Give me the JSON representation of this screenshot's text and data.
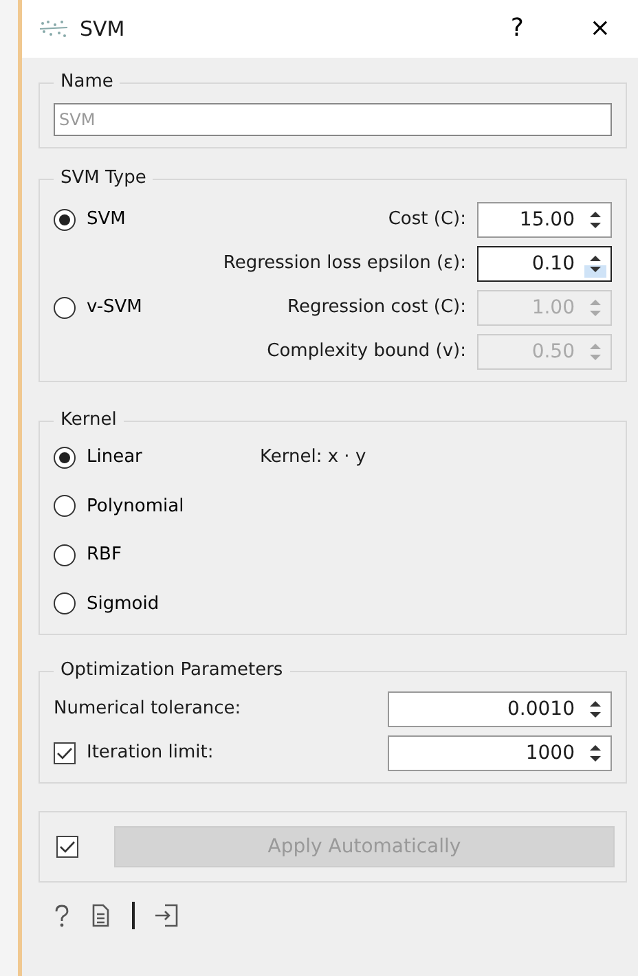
{
  "window": {
    "title": "SVM",
    "help": "?",
    "close": "×"
  },
  "name_box": {
    "title": "Name",
    "placeholder": "SVM"
  },
  "svm_type": {
    "title": "SVM Type",
    "options": [
      {
        "label": "SVM",
        "selected": true
      },
      {
        "label": "v-SVM",
        "selected": false
      }
    ],
    "params": [
      {
        "label": "Cost (C):",
        "value": "15.00",
        "disabled": false,
        "focused": false
      },
      {
        "label": "Regression loss epsilon (ε):",
        "value": "0.10",
        "disabled": false,
        "focused": true
      },
      {
        "label": "Regression cost (C):",
        "value": "1.00",
        "disabled": true,
        "focused": false
      },
      {
        "label": "Complexity bound (v):",
        "value": "0.50",
        "disabled": true,
        "focused": false
      }
    ]
  },
  "kernel": {
    "title": "Kernel",
    "formula": "Kernel: x · y",
    "options": [
      {
        "label": "Linear",
        "selected": true
      },
      {
        "label": "Polynomial",
        "selected": false
      },
      {
        "label": "RBF",
        "selected": false
      },
      {
        "label": "Sigmoid",
        "selected": false
      }
    ]
  },
  "optimization": {
    "title": "Optimization Parameters",
    "rows": [
      {
        "kind": "label",
        "label": "Numerical tolerance:",
        "value": "0.0010"
      },
      {
        "kind": "checkbox",
        "label": "Iteration limit:",
        "checked": true,
        "value": "1000"
      }
    ]
  },
  "apply": {
    "checked": true,
    "label": "Apply Automatically",
    "disabled": true
  }
}
